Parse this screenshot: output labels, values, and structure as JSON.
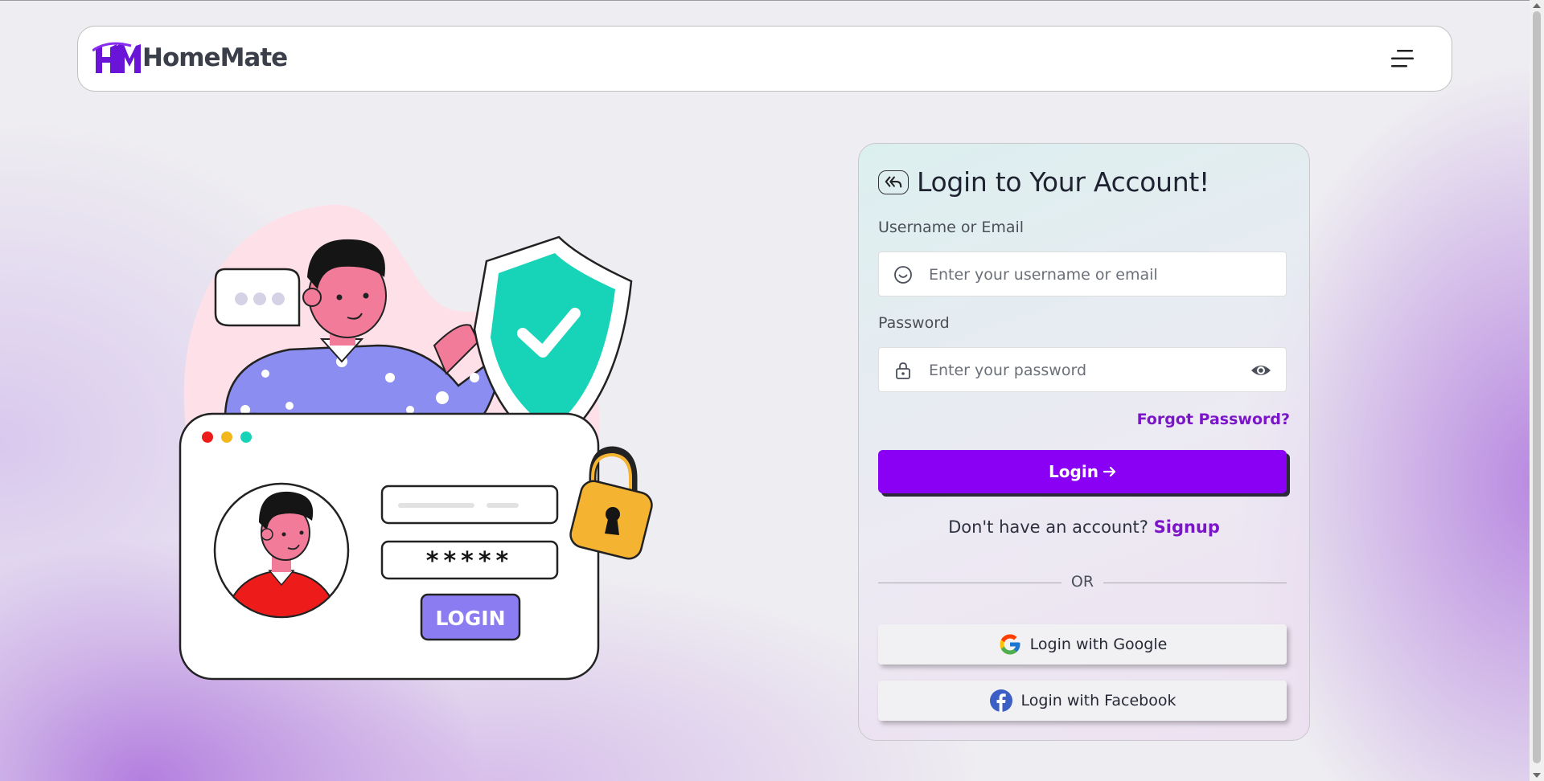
{
  "brand": {
    "name": "HomeMate",
    "logo_letters": "HM",
    "accent": "#8a00f5"
  },
  "navbar": {
    "menu_icon": "hamburger-menu-icon"
  },
  "illustration": {
    "login_label": "LOGIN",
    "password_mask": "*****"
  },
  "login": {
    "title": "Login to Your Account!",
    "back_icon": "back-arrow-icon",
    "username": {
      "label": "Username or Email",
      "placeholder": "Enter your username or email",
      "value": "",
      "icon": "smile-icon"
    },
    "password": {
      "label": "Password",
      "placeholder": "Enter your password",
      "value": "",
      "icon": "lock-icon",
      "toggle_icon": "eye-icon"
    },
    "forgot": "Forgot Password?",
    "submit": "Login",
    "no_account": "Don't have an account?",
    "signup": "Signup",
    "or": "OR",
    "google": "Login with Google",
    "facebook": "Login with Facebook"
  }
}
